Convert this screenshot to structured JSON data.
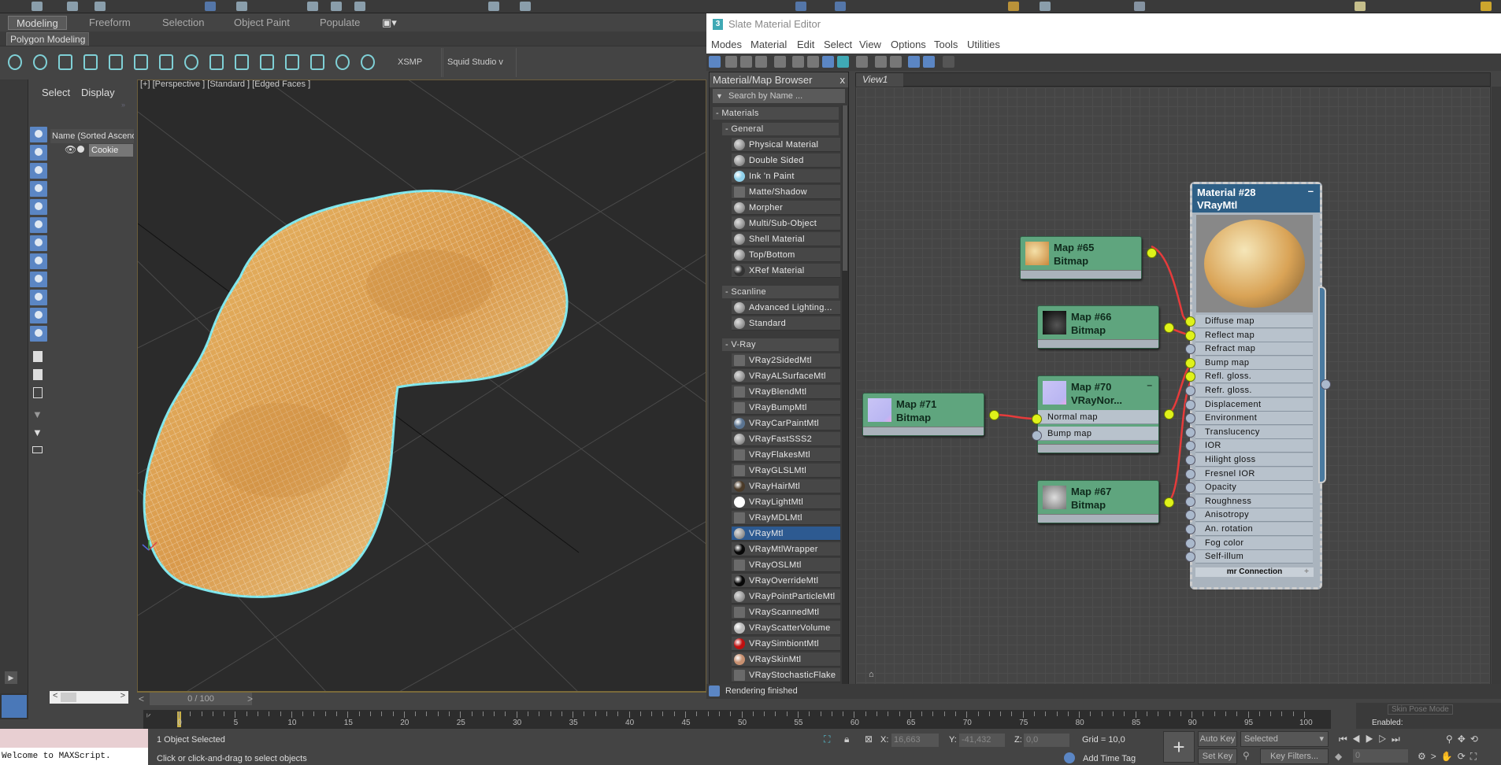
{
  "ribbon": {
    "tabs": [
      "Modeling",
      "Freeform",
      "Selection",
      "Object Paint",
      "Populate"
    ],
    "sub_tab": "Polygon Modeling",
    "xsmp_label": "XSMP",
    "squid_label": "Squid Studio v"
  },
  "scene_explorer": {
    "tabs": [
      "Select",
      "Display"
    ],
    "column_header": "Name (Sorted Ascending)",
    "objects": [
      "Cookie"
    ]
  },
  "viewport": {
    "label": "[+] [Perspective ] [Standard ] [Edged Faces ]"
  },
  "slate": {
    "title": "Slate Material Editor",
    "menu": [
      "Modes",
      "Material",
      "Edit",
      "Select",
      "View",
      "Options",
      "Tools",
      "Utilities"
    ],
    "browser": {
      "title": "Material/Map Browser",
      "close": "x",
      "search_placeholder": "Search by Name ...",
      "root": "- Materials",
      "groups": [
        {
          "label": "- General",
          "items": [
            [
              "Physical Material",
              "sphere"
            ],
            [
              "Double Sided",
              "sphere"
            ],
            [
              "Ink 'n Paint",
              "#8fd0ea"
            ],
            [
              "Matte/Shadow",
              "flat"
            ],
            [
              "Morpher",
              "sphere"
            ],
            [
              "Multi/Sub-Object",
              "sphere"
            ],
            [
              "Shell Material",
              "sphere"
            ],
            [
              "Top/Bottom",
              "sphere"
            ],
            [
              "XRef Material",
              "#333"
            ]
          ]
        },
        {
          "label": "- Scanline",
          "items": [
            [
              "Advanced Lighting...",
              "sphere"
            ],
            [
              "Standard",
              "sphere"
            ]
          ]
        },
        {
          "label": "- V-Ray",
          "items": [
            [
              "VRay2SidedMtl",
              "flat"
            ],
            [
              "VRayALSurfaceMtl",
              "sphere"
            ],
            [
              "VRayBlendMtl",
              "flat"
            ],
            [
              "VRayBumpMtl",
              "flat"
            ],
            [
              "VRayCarPaintMtl",
              "#5a7390"
            ],
            [
              "VRayFastSSS2",
              "sphere"
            ],
            [
              "VRayFlakesMtl",
              "flat"
            ],
            [
              "VRayGLSLMtl",
              "flat"
            ],
            [
              "VRayHairMtl",
              "#4a3a28"
            ],
            [
              "VRayLightMtl",
              "#ffffff"
            ],
            [
              "VRayMDLMtl",
              "flat"
            ],
            [
              "VRayMtl",
              "sphere"
            ],
            [
              "VRayMtlWrapper",
              "#080808"
            ],
            [
              "VRayOSLMtl",
              "flat"
            ],
            [
              "VRayOverrideMtl",
              "#080808"
            ],
            [
              "VRayPointParticleMtl",
              "sphere"
            ],
            [
              "VRayScannedMtl",
              "flat"
            ],
            [
              "VRayScatterVolume",
              "#bbbbbb"
            ],
            [
              "VRaySimbiontMtl",
              "#c01010"
            ],
            [
              "VRaySkinMtl",
              "#c89070"
            ],
            [
              "VRayStochasticFlake",
              "flat"
            ]
          ]
        }
      ],
      "selected": "VRayMtl"
    },
    "view_tab": "View1",
    "nodes": {
      "map65": {
        "name": "Map #65",
        "type": "Bitmap"
      },
      "map66": {
        "name": "Map #66",
        "type": "Bitmap"
      },
      "map70": {
        "name": "Map #70",
        "type": "VRayNor...",
        "inputs": [
          "Normal map",
          "Bump map"
        ]
      },
      "map71": {
        "name": "Map #71",
        "type": "Bitmap"
      },
      "map67": {
        "name": "Map #67",
        "type": "Bitmap"
      },
      "material": {
        "name": "Material #28",
        "type": "VRayMtl",
        "slots": [
          "Diffuse map",
          "Reflect map",
          "Refract map",
          "Bump map",
          "Refl. gloss.",
          "Refr. gloss.",
          "Displacement",
          "Environment",
          "Translucency",
          "IOR",
          "Hilight gloss",
          "Fresnel IOR",
          "Opacity",
          "Roughness",
          "Anisotropy",
          "An. rotation",
          "Fog color",
          "Self-illum"
        ],
        "connected": [
          "Diffuse map",
          "Reflect map",
          "Bump map",
          "Refl. gloss."
        ],
        "footer": "mr Connection"
      }
    },
    "status": "Rendering finished"
  },
  "timeline": {
    "frame": "0 / 100",
    "ticks": [
      "0",
      "5",
      "10",
      "15",
      "20",
      "25",
      "30",
      "35",
      "40",
      "45",
      "50",
      "55",
      "60",
      "65",
      "70",
      "75",
      "80",
      "85",
      "90",
      "95",
      "100"
    ]
  },
  "statusbar": {
    "maxscript": "Welcome to MAXScript.",
    "selection": "1 Object Selected",
    "prompt": "Click or click-and-drag to select objects",
    "x_label": "X:",
    "x": "16,663",
    "y_label": "Y:",
    "y": "-41,432",
    "z_label": "Z:",
    "z": "0,0",
    "grid": "Grid = 10,0",
    "add_time_tag": "Add Time Tag",
    "auto_key": "Auto Key",
    "set_key": "Set Key",
    "key_mode": "Selected",
    "key_filters": "Key Filters...",
    "current_frame": "0",
    "skin_pose": "Skin Pose Mode",
    "enabled": "Enabled:"
  }
}
